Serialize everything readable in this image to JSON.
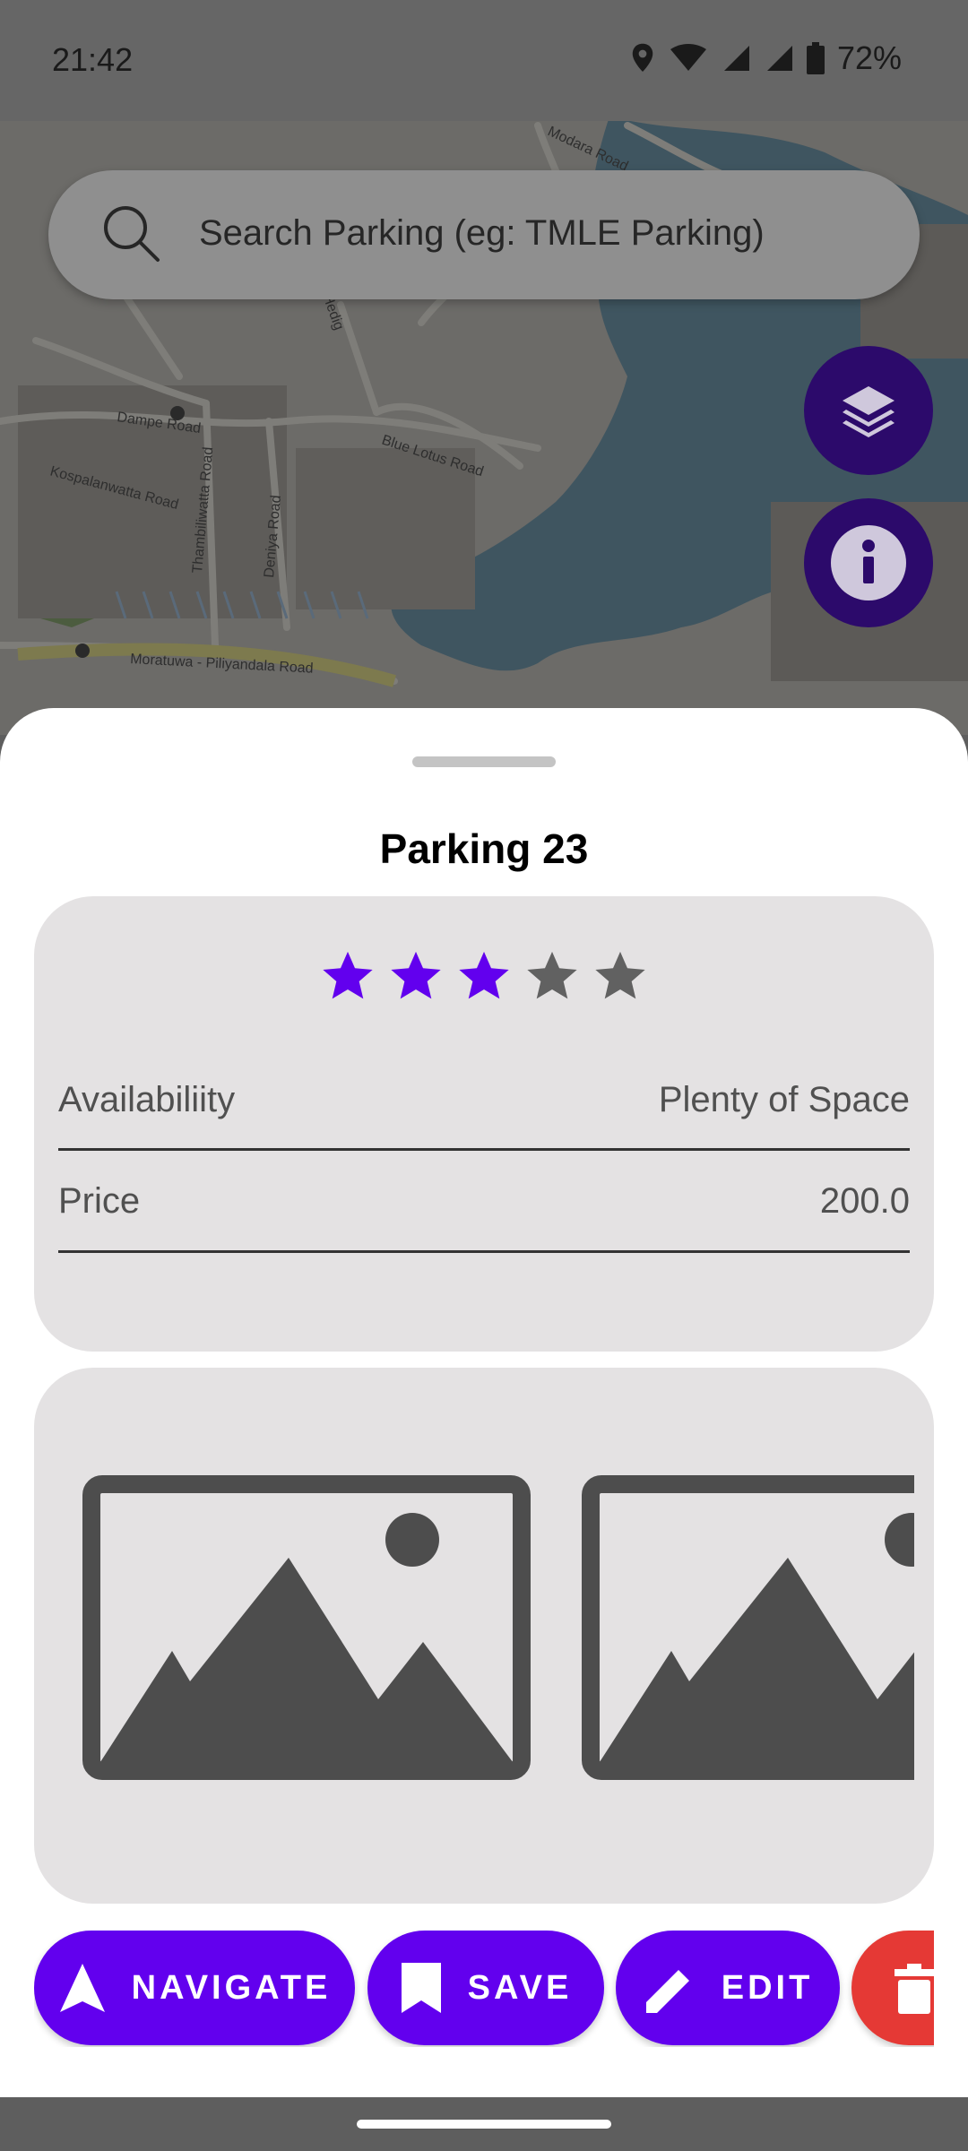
{
  "status_bar": {
    "time": "21:42",
    "battery": "72%",
    "icons": [
      "location-icon",
      "wifi-icon",
      "signal-icon",
      "signal-icon",
      "battery-icon"
    ]
  },
  "map": {
    "labels": [
      "Dampe Road",
      "Kospalanwatta Road",
      "Thambiliwatta Road",
      "Deniya Road",
      "Blue Lotus Road",
      "Moratuwa - Piliyandala Road",
      "Hedig",
      "Modara Road"
    ]
  },
  "search": {
    "placeholder": "Search Parking (eg: TMLE Parking)"
  },
  "fabs": {
    "layers_icon": "layers-icon",
    "info_icon": "info-icon",
    "color": "#2c0a6b"
  },
  "sheet": {
    "title": "Parking 23",
    "rating": {
      "value": 3,
      "max": 5,
      "filled_color": "#6200ee",
      "empty_color": "#616161"
    },
    "details": [
      {
        "label": "Availabiliity",
        "value": "Plenty of Space"
      },
      {
        "label": "Price",
        "value": "200.0"
      }
    ],
    "images": [
      "image-placeholder-icon",
      "image-placeholder-icon"
    ]
  },
  "actions": {
    "navigate": "NAVIGATE",
    "save": "SAVE",
    "edit": "EDIT",
    "delete_icon": "trash-icon",
    "primary_color": "#6200ee",
    "danger_color": "#e53935"
  }
}
